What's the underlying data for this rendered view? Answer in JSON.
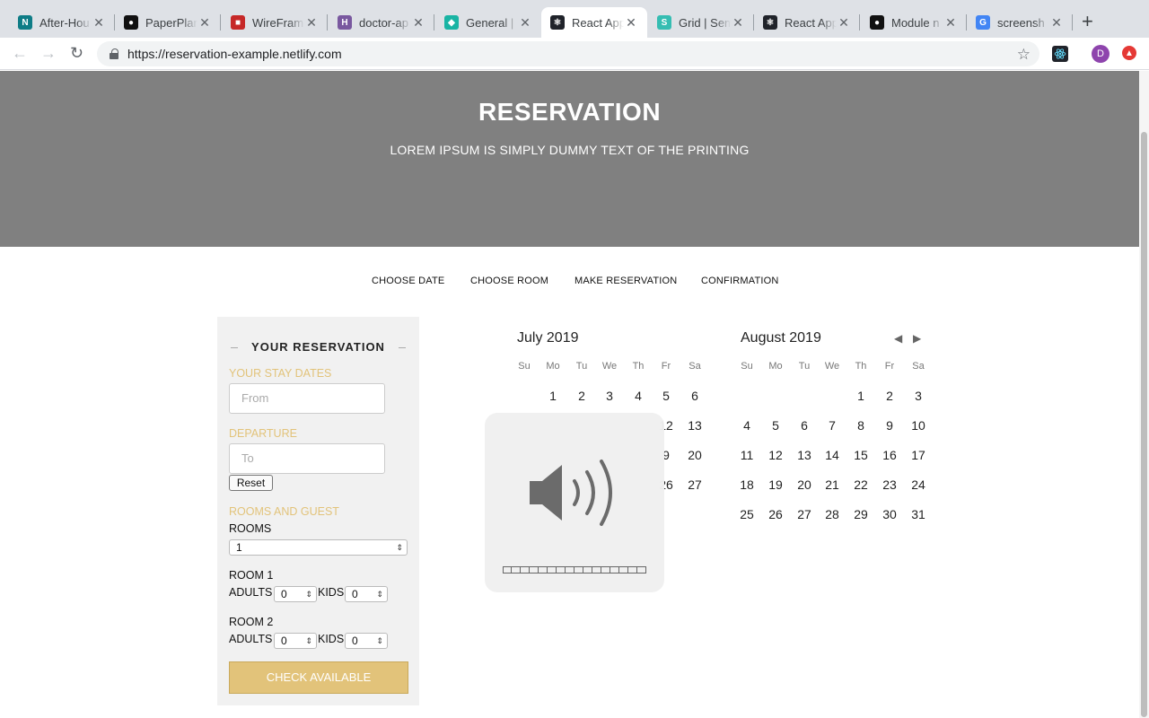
{
  "browser": {
    "tabs": [
      {
        "title": "After-Hou",
        "icon": "netlify-icon",
        "color": "#0e7c86"
      },
      {
        "title": "PaperPlan",
        "icon": "github-icon",
        "color": "#111111"
      },
      {
        "title": "WireFram",
        "icon": "wireframe-icon",
        "color": "#c62828"
      },
      {
        "title": "doctor-ap",
        "icon": "heroku-icon",
        "color": "#79589f"
      },
      {
        "title": "General |",
        "icon": "diamond-icon",
        "color": "#19b4a4"
      },
      {
        "title": "React App",
        "icon": "react-icon",
        "color": "#20232a"
      },
      {
        "title": "Grid | Sem",
        "icon": "semantic-icon",
        "color": "#35bdb2"
      },
      {
        "title": "React App",
        "icon": "react-icon",
        "color": "#20232a"
      },
      {
        "title": "Module n",
        "icon": "github-icon",
        "color": "#111111"
      },
      {
        "title": "screensh",
        "icon": "google-icon",
        "color": "#4285f4"
      }
    ],
    "active_tab": 5,
    "url": "https://reservation-example.netlify.com",
    "profile_initial": "D"
  },
  "hero": {
    "title": "RESERVATION",
    "subtitle": "LOREM IPSUM IS SIMPLY DUMMY TEXT OF THE PRINTING"
  },
  "steps": [
    "CHOOSE DATE",
    "CHOOSE ROOM",
    "MAKE RESERVATION",
    "CONFIRMATION"
  ],
  "panel": {
    "title": "YOUR RESERVATION",
    "stay_label": "YOUR STAY DATES",
    "from_placeholder": "From",
    "departure_label": "DEPARTURE",
    "to_placeholder": "To",
    "reset_label": "Reset",
    "rooms_guest_label": "ROOMS AND GUEST",
    "rooms_label": "ROOMS",
    "rooms_value": "1",
    "room1": {
      "label": "ROOM 1",
      "adults_label": "ADULTS",
      "adults": "0",
      "kids_label": "KIDS",
      "kids": "0"
    },
    "room2": {
      "label": "ROOM 2",
      "adults_label": "ADULTS",
      "adults": "0",
      "kids_label": "KIDS",
      "kids": "0"
    },
    "check_label": "CHECK AVAILABLE"
  },
  "calendar": {
    "weekdays": [
      "Su",
      "Mo",
      "Tu",
      "We",
      "Th",
      "Fr",
      "Sa"
    ],
    "months": [
      {
        "name": "July 2019",
        "rows": [
          [
            "",
            "1",
            "2",
            "3",
            "4",
            "5",
            "6"
          ],
          [
            "",
            "",
            "",
            "",
            "",
            "12",
            "13"
          ],
          [
            "",
            "",
            "",
            "",
            "",
            "9",
            "20"
          ],
          [
            "",
            "",
            "",
            "",
            "",
            "26",
            "27"
          ]
        ]
      },
      {
        "name": "August 2019",
        "rows": [
          [
            "",
            "",
            "",
            "",
            "1",
            "2",
            "3"
          ],
          [
            "4",
            "5",
            "6",
            "7",
            "8",
            "9",
            "10"
          ],
          [
            "11",
            "12",
            "13",
            "14",
            "15",
            "16",
            "17"
          ],
          [
            "18",
            "19",
            "20",
            "21",
            "22",
            "23",
            "24"
          ],
          [
            "25",
            "26",
            "27",
            "28",
            "29",
            "30",
            "31"
          ]
        ]
      }
    ]
  },
  "volume_hud": {
    "level_segments": 16,
    "filled": 0
  }
}
